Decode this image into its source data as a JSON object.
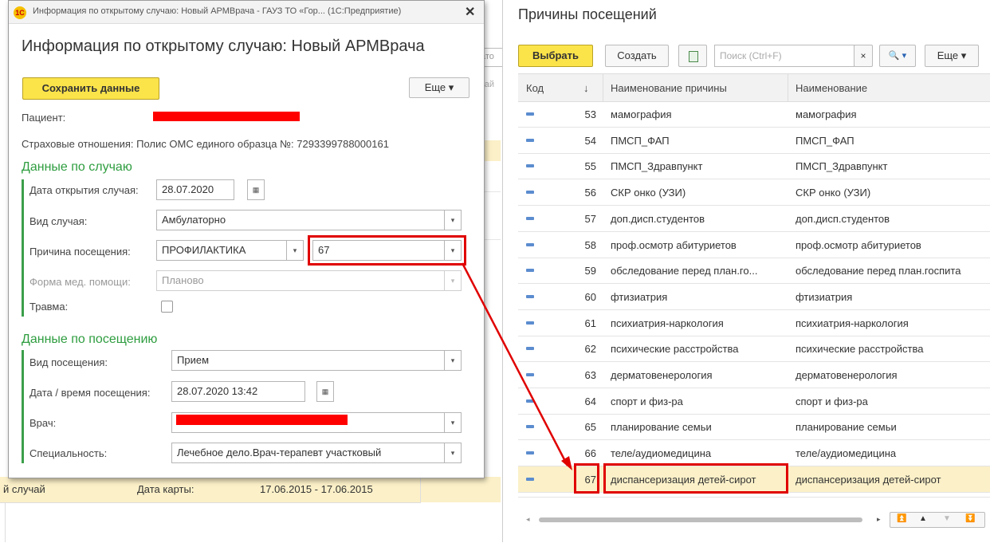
{
  "background": {
    "strip_text": "ато",
    "strip_text2": "чай",
    "row_label": "й случай",
    "row_date_label": "Дата карты:",
    "row_date_value": "17.06.2015 - 17.06.2015"
  },
  "dialog": {
    "window_title": "Информация по открытому случаю: Новый АРМВрача - ГАУЗ ТО «Гор... (1С:Предприятие)",
    "logo": "1С",
    "close_glyph": "✕",
    "heading": "Информация по открытому случаю: Новый АРМВрача",
    "save_label": "Сохранить данные",
    "more_label": "Еще ▾",
    "patient_label": "Пациент:",
    "insurance_text": "Страховые отношения: Полис ОМС единого образца №: 7293399788000161",
    "case_section": "Данные по случаю",
    "open_date_label": "Дата открытия случая:",
    "open_date_value": "28.07.2020",
    "case_type_label": "Вид случая:",
    "case_type_value": "Амбулаторно",
    "reason_label": "Причина посещения:",
    "reason_value": "ПРОФИЛАКТИКА",
    "reason_code": "67",
    "care_form_label": "Форма мед. помощи:",
    "care_form_value": "Планово",
    "trauma_label": "Травма:",
    "visit_section": "Данные по посещению",
    "visit_type_label": "Вид посещения:",
    "visit_type_value": "Прием",
    "visit_datetime_label": "Дата / время посещения:",
    "visit_datetime_value": "28.07.2020 13:42",
    "doctor_label": "Врач:",
    "specialty_label": "Специальность:",
    "specialty_value": "Лечебное дело.Врач-терапевт участковый"
  },
  "reasons_panel": {
    "title": "Причины посещений",
    "select_label": "Выбрать",
    "create_label": "Создать",
    "search_placeholder": "Поиск (Ctrl+F)",
    "clear_glyph": "×",
    "search_glyph": "🔍 ▾",
    "more_label": "Еще ▾",
    "columns": [
      "Код",
      "↓",
      "Наименование причины",
      "Наименование"
    ],
    "rows": [
      {
        "code": "53",
        "reason": "мамография",
        "name": "мамография"
      },
      {
        "code": "54",
        "reason": "ПМСП_ФАП",
        "name": "ПМСП_ФАП"
      },
      {
        "code": "55",
        "reason": "ПМСП_Здравпункт",
        "name": "ПМСП_Здравпункт"
      },
      {
        "code": "56",
        "reason": "СКР онко (УЗИ)",
        "name": "СКР онко (УЗИ)"
      },
      {
        "code": "57",
        "reason": "доп.дисп.студентов",
        "name": "доп.дисп.студентов"
      },
      {
        "code": "58",
        "reason": "проф.осмотр абитуриетов",
        "name": "проф.осмотр абитуриетов"
      },
      {
        "code": "59",
        "reason": "обследование перед план.го...",
        "name": "обследование перед план.госпита"
      },
      {
        "code": "60",
        "reason": "фтизиатрия",
        "name": "фтизиатрия"
      },
      {
        "code": "61",
        "reason": "психиатрия-наркология",
        "name": "психиатрия-наркология"
      },
      {
        "code": "62",
        "reason": "психические расстройства",
        "name": "психические расстройства"
      },
      {
        "code": "63",
        "reason": "дерматовенерология",
        "name": "дерматовенерология"
      },
      {
        "code": "64",
        "reason": "спорт и физ-ра",
        "name": "спорт и физ-ра"
      },
      {
        "code": "65",
        "reason": "планирование семьи",
        "name": "планирование семьи"
      },
      {
        "code": "66",
        "reason": "теле/аудиомедицина",
        "name": "теле/аудиомедицина"
      },
      {
        "code": "67",
        "reason": "диспансеризация детей-сирот",
        "name": "диспансеризация детей-сирот"
      }
    ],
    "selected_code": "67"
  },
  "colors": {
    "accent_yellow": "#fbe34a",
    "section_green": "#2e9d3f",
    "highlight_red": "#e00000",
    "selected_row": "#fbf0c8"
  }
}
